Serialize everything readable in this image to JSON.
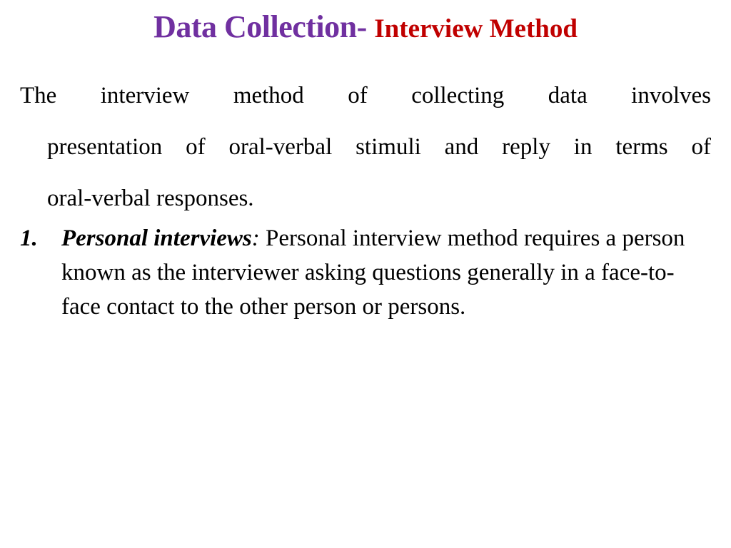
{
  "slide": {
    "title_main": "Data Collection- ",
    "title_sub": "Interview Method",
    "colors": {
      "title_main": "#7030a0",
      "title_sub": "#c00000",
      "body_text": "#000000"
    },
    "intro": {
      "line1": "The interview method of collecting data involves",
      "line2": "presentation of oral-verbal stimuli and reply in terms of",
      "line3": "oral-verbal responses."
    },
    "list": [
      {
        "number": "1.",
        "term": "Personal interviews",
        "separator": ":",
        "description": " Personal interview method requires a person known as the interviewer asking questions generally in a face-to-face contact to the other person or persons."
      }
    ]
  }
}
